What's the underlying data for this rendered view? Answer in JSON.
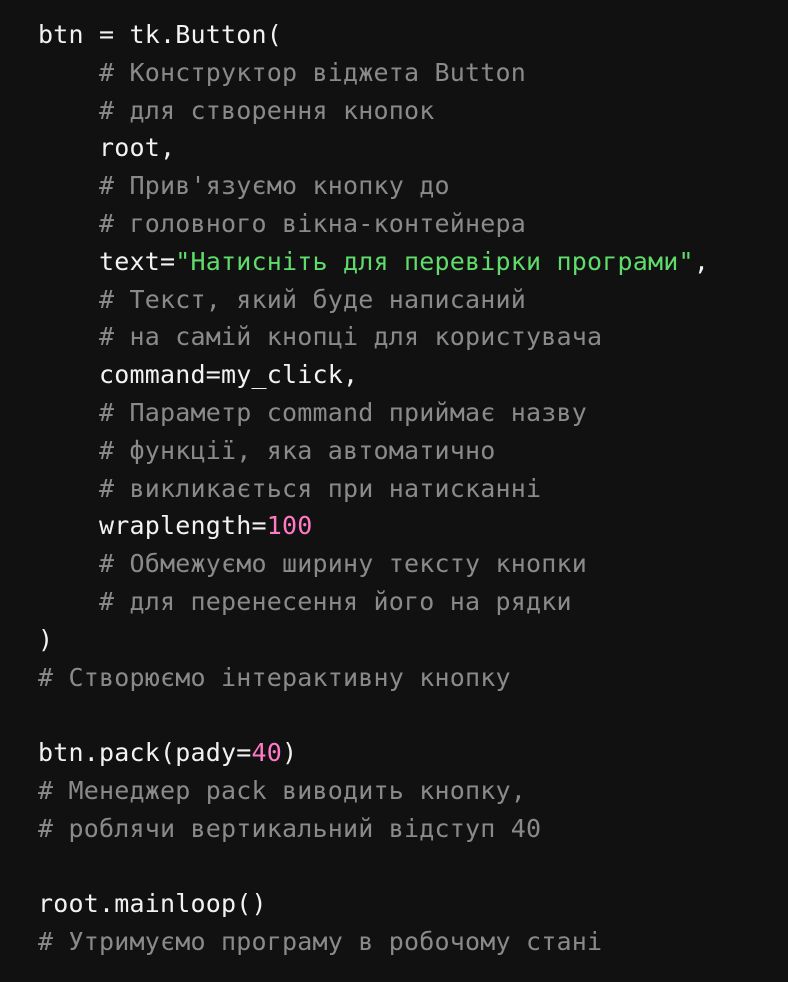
{
  "code": {
    "l1": "btn = tk.Button(",
    "l2": "# Конструктор віджета Button",
    "l3": "# для створення кнопок",
    "l4": "root,",
    "l5": "# Прив'язуємо кнопку до",
    "l6": "# головного вікна-контейнера",
    "l7": {
      "key": "text=",
      "str": "\"Натисніть для перевірки програми\"",
      "tail": ","
    },
    "l8": "# Текст, який буде написаний",
    "l9": "# на самій кнопці для користувача",
    "l10": "command=my_click,",
    "l11": "# Параметр command приймає назву",
    "l12": "# функції, яка автоматично",
    "l13": "# викликається при натисканні",
    "l14": {
      "key": "wraplength=",
      "num": "100"
    },
    "l15": "# Обмежуємо ширину тексту кнопки",
    "l16": "# для перенесення його на рядки",
    "l17": ")",
    "l18": "# Створюємо інтерактивну кнопку",
    "l20": {
      "pre": "btn.pack(pady=",
      "num": "40",
      "post": ")"
    },
    "l21": "# Менеджер pack виводить кнопку,",
    "l22": "# роблячи вертикальний відступ 40",
    "l24": "root.mainloop()",
    "l25": "# Утримуємо програму в робочому стані"
  },
  "colors": {
    "background": "#111111",
    "text": "#f2f2f2",
    "comment": "#8a8a8a",
    "string": "#5fdc6a",
    "number": "#ff79c6"
  }
}
